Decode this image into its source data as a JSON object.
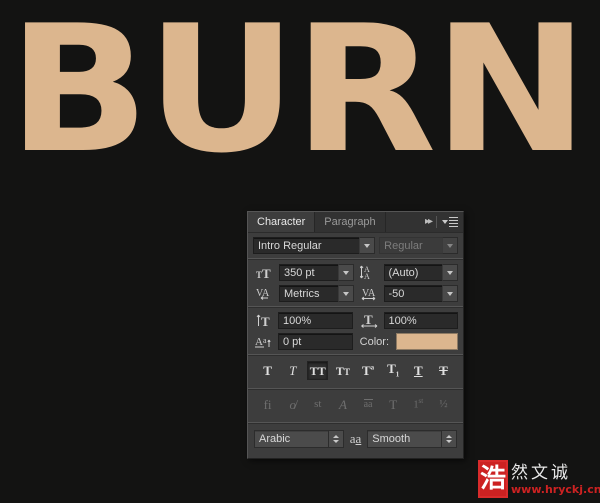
{
  "canvas": {
    "artwork_text": "BURN",
    "artwork_color": "#dcb68e",
    "background_color": "#131312"
  },
  "panel": {
    "tabs": [
      {
        "label": "Character",
        "active": true
      },
      {
        "label": "Paragraph",
        "active": false
      }
    ],
    "header_icons": {
      "collapse": "double-chevron-right-icon",
      "menu": "panel-menu-icon"
    },
    "font": {
      "family_value": "Intro  Regular",
      "style_value": "Regular",
      "family_icon": "font-family-dropdown",
      "style_icon": "font-style-dropdown"
    },
    "metrics": {
      "size_icon": "font-size-icon",
      "size_value": "350 pt",
      "leading_icon": "leading-icon",
      "leading_value": "(Auto)",
      "kerning_icon": "kerning-icon",
      "kerning_value": "Metrics",
      "tracking_icon": "tracking-icon",
      "tracking_value": "-50"
    },
    "scale": {
      "vertical_icon": "vertical-scale-icon",
      "vertical_value": "100%",
      "horizontal_icon": "horizontal-scale-icon",
      "horizontal_value": "100%",
      "baseline_icon": "baseline-shift-icon",
      "baseline_value": "0 pt",
      "color_label": "Color:",
      "color_value": "#dcb68e"
    },
    "style_buttons": [
      {
        "name": "faux-bold",
        "glyph": "T",
        "active": false,
        "enabled": true
      },
      {
        "name": "faux-italic",
        "glyph": "T",
        "active": false,
        "enabled": true
      },
      {
        "name": "all-caps",
        "glyph": "TT",
        "active": true,
        "enabled": true
      },
      {
        "name": "small-caps",
        "glyph": "Tт",
        "active": false,
        "enabled": true
      },
      {
        "name": "superscript",
        "glyph": "T¹",
        "active": false,
        "enabled": true
      },
      {
        "name": "subscript",
        "glyph": "T₁",
        "active": false,
        "enabled": true
      },
      {
        "name": "underline",
        "glyph": "T",
        "active": false,
        "enabled": true
      },
      {
        "name": "strikethrough",
        "glyph": "Ŧ",
        "active": false,
        "enabled": true
      }
    ],
    "opentype_buttons": [
      {
        "name": "standard-ligatures",
        "glyph": "fi",
        "enabled": false
      },
      {
        "name": "contextual-alternates",
        "glyph": "o̸",
        "enabled": false
      },
      {
        "name": "discretionary-ligatures",
        "glyph": "st",
        "enabled": false
      },
      {
        "name": "swash",
        "glyph": "A",
        "enabled": false
      },
      {
        "name": "stylistic-alternates",
        "glyph": "aa",
        "enabled": false
      },
      {
        "name": "titling-alternates",
        "glyph": "T",
        "enabled": false
      },
      {
        "name": "ordinals",
        "glyph": "1st",
        "enabled": false
      },
      {
        "name": "fractions",
        "glyph": "½",
        "enabled": false
      }
    ],
    "bottom": {
      "language_value": "Arabic",
      "aa_icon_label": "aa",
      "antialias_value": "Smooth"
    }
  },
  "watermark": {
    "seal_char": "浩",
    "cn_text": "然文诚",
    "url": "www.hryckj.cn",
    "seal_color": "#cc2222"
  }
}
